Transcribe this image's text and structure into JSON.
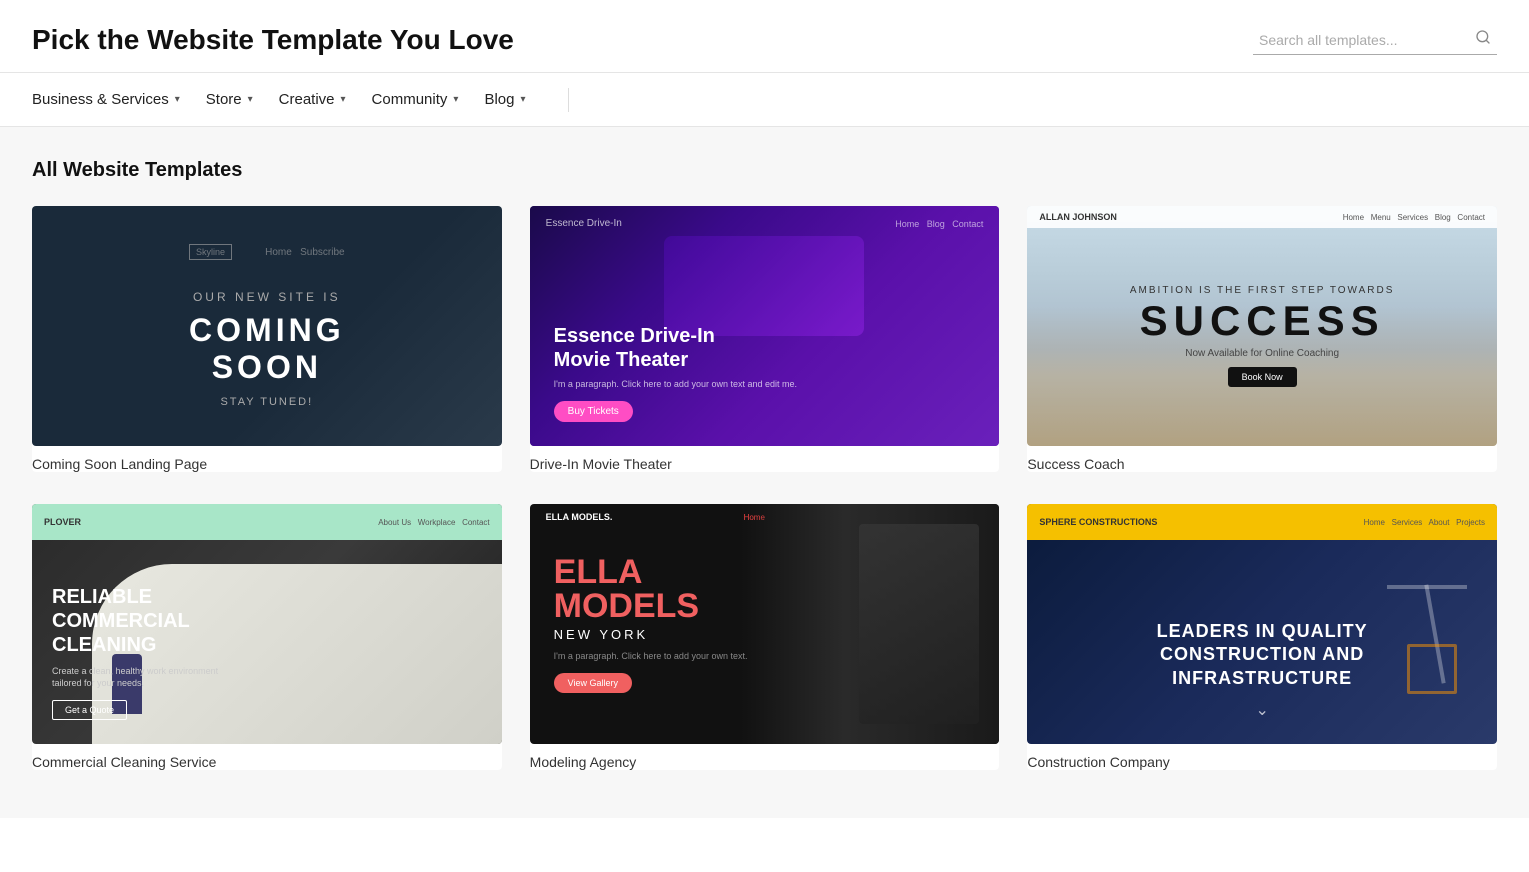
{
  "header": {
    "title": "Pick the Website Template You Love",
    "search_placeholder": "Search all templates..."
  },
  "nav": {
    "items": [
      {
        "label": "Business & Services",
        "has_dropdown": true
      },
      {
        "label": "Store",
        "has_dropdown": true
      },
      {
        "label": "Creative",
        "has_dropdown": true
      },
      {
        "label": "Community",
        "has_dropdown": true
      },
      {
        "label": "Blog",
        "has_dropdown": true
      }
    ]
  },
  "main": {
    "section_title": "All Website Templates",
    "templates": [
      {
        "id": "coming-soon",
        "name": "Coming Soon Landing Page",
        "thumb_type": "coming-soon",
        "thumb_text1": "COMING",
        "thumb_text2": "SOON",
        "thumb_sub": "STAY TUNED!"
      },
      {
        "id": "drive-in",
        "name": "Drive-In Movie Theater",
        "thumb_type": "drive-in",
        "thumb_text1": "Essence Drive-In",
        "thumb_text2": "Movie Theater",
        "thumb_btn": "Buy Tickets"
      },
      {
        "id": "success-coach",
        "name": "Success Coach",
        "thumb_type": "success",
        "thumb_text1": "SUCCESS",
        "thumb_sub": "Now Available for Online Coaching"
      },
      {
        "id": "cleaning",
        "name": "Commercial Cleaning Service",
        "thumb_type": "cleaning",
        "thumb_text1": "RELIABLE COMMERCIAL CLEANING"
      },
      {
        "id": "modeling",
        "name": "Modeling Agency",
        "thumb_type": "modeling",
        "thumb_text1": "ELLA MODELS",
        "thumb_sub": "NEW YORK"
      },
      {
        "id": "construction",
        "name": "Construction Company",
        "thumb_type": "construction",
        "thumb_text1": "LEADERS IN QUALITY CONSTRUCTION AND INFRASTRUCTURE"
      }
    ]
  }
}
